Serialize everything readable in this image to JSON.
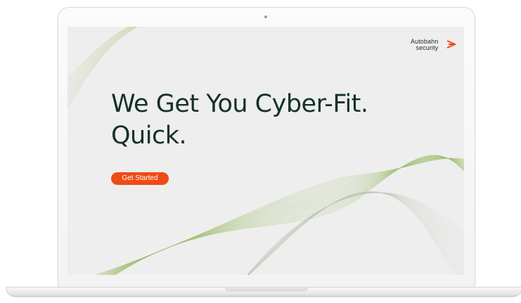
{
  "brand": {
    "name_line1": "Autobahn",
    "name_line2": "security",
    "accent_color": "#ef4b17",
    "text_color": "#15302a",
    "logo_icon": "chevron-right-arrow-icon"
  },
  "hero": {
    "headline_line1": "We Get You Cyber-Fit.",
    "headline_line2": "Quick.",
    "cta_label": "Get Started"
  },
  "device": {
    "frame": "laptop",
    "screen_background": "#eeeeee",
    "decoration": "green-wave-lines"
  }
}
